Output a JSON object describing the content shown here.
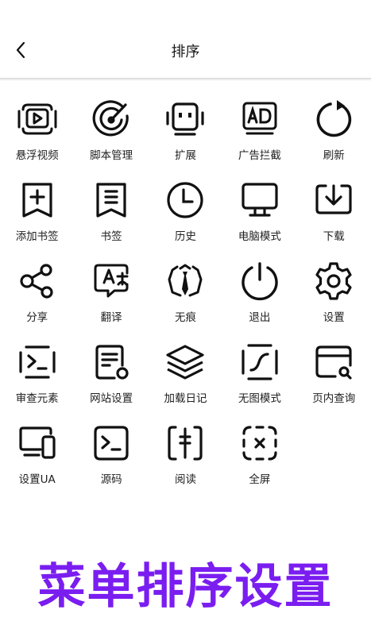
{
  "header": {
    "title": "排序",
    "back_icon": "chevron-left-icon"
  },
  "menu": {
    "items": [
      {
        "id": "float-video",
        "label": "悬浮视频",
        "icon": "floating-video-icon"
      },
      {
        "id": "script-manager",
        "label": "脚本管理",
        "icon": "script-manager-icon"
      },
      {
        "id": "extensions",
        "label": "扩展",
        "icon": "extension-robot-icon"
      },
      {
        "id": "adblock",
        "label": "广告拦截",
        "icon": "ad-block-icon"
      },
      {
        "id": "refresh",
        "label": "刷新",
        "icon": "refresh-icon"
      },
      {
        "id": "add-bookmark",
        "label": "添加书签",
        "icon": "add-bookmark-icon"
      },
      {
        "id": "bookmarks",
        "label": "书签",
        "icon": "bookmark-icon"
      },
      {
        "id": "history",
        "label": "历史",
        "icon": "clock-icon"
      },
      {
        "id": "desktop-mode",
        "label": "电脑模式",
        "icon": "monitor-icon"
      },
      {
        "id": "download",
        "label": "下载",
        "icon": "download-icon"
      },
      {
        "id": "share",
        "label": "分享",
        "icon": "share-icon"
      },
      {
        "id": "translate",
        "label": "翻译",
        "icon": "translate-icon"
      },
      {
        "id": "incognito",
        "label": "无痕",
        "icon": "incognito-icon"
      },
      {
        "id": "exit",
        "label": "退出",
        "icon": "power-icon"
      },
      {
        "id": "settings",
        "label": "设置",
        "icon": "gear-icon"
      },
      {
        "id": "inspect",
        "label": "审查元素",
        "icon": "terminal-icon"
      },
      {
        "id": "site-settings",
        "label": "网站设置",
        "icon": "site-settings-icon"
      },
      {
        "id": "load-log",
        "label": "加载日记",
        "icon": "layers-icon"
      },
      {
        "id": "no-image",
        "label": "无图模式",
        "icon": "no-image-icon"
      },
      {
        "id": "find-in-page",
        "label": "页内查询",
        "icon": "find-in-page-icon"
      },
      {
        "id": "user-agent",
        "label": "设置UA",
        "icon": "devices-icon"
      },
      {
        "id": "source",
        "label": "源码",
        "icon": "source-code-icon"
      },
      {
        "id": "reader",
        "label": "阅读",
        "icon": "reader-icon"
      },
      {
        "id": "fullscreen",
        "label": "全屏",
        "icon": "fullscreen-icon"
      }
    ]
  },
  "banner": {
    "text": "菜单排序设置",
    "color": "#7a1df0"
  }
}
